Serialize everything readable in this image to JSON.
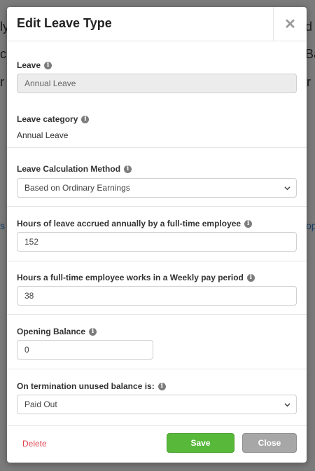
{
  "background": {
    "left_fragments": [
      "ly",
      "c",
      "r",
      "s"
    ],
    "right_fragments": [
      "d",
      "Ba",
      "r",
      "op"
    ]
  },
  "modal": {
    "title": "Edit Leave Type",
    "close_glyph": "✕"
  },
  "form": {
    "leave": {
      "label": "Leave",
      "value": "Annual Leave"
    },
    "leave_category": {
      "label": "Leave category",
      "value": "Annual Leave"
    },
    "calculation_method": {
      "label": "Leave Calculation Method",
      "value": "Based on Ordinary Earnings"
    },
    "hours_accrued": {
      "label": "Hours of leave accrued annually by a full-time employee",
      "value": "152"
    },
    "hours_weekly": {
      "label": "Hours a full-time employee works in a Weekly pay period",
      "value": "38"
    },
    "opening_balance": {
      "label": "Opening Balance",
      "value": "0"
    },
    "termination": {
      "label": "On termination unused balance is:",
      "value": "Paid Out"
    }
  },
  "footer": {
    "delete_label": "Delete",
    "save_label": "Save",
    "close_label": "Close"
  },
  "colors": {
    "save_green": "#58b83a",
    "close_gray": "#a7a7a7",
    "delete_red": "#e0424d"
  }
}
